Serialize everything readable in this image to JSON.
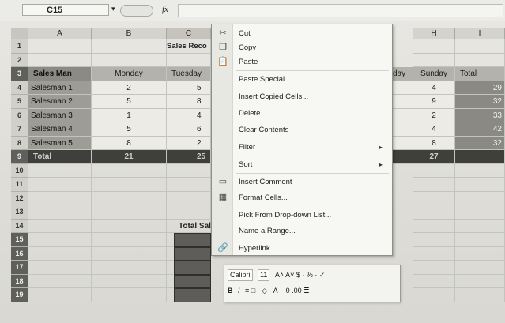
{
  "formula_bar": {
    "name_box": "C15",
    "fx": "fx"
  },
  "columns": [
    "A",
    "B",
    "C",
    "H",
    "I"
  ],
  "columns_partial": {
    "D_label": "day"
  },
  "rows": [
    "1",
    "2",
    "3",
    "4",
    "5",
    "6",
    "7",
    "8",
    "9",
    "10",
    "11",
    "12",
    "13",
    "14",
    "15",
    "16",
    "17",
    "18",
    "19"
  ],
  "sheet": {
    "title": "Sales Reco",
    "headers": {
      "a": "Sales Man",
      "b": "Monday",
      "c": "Tuesday",
      "d": "day",
      "h": "Sunday",
      "i": "Total"
    },
    "people": [
      {
        "name": "Salesman 1",
        "monday": "2",
        "tuesday": "5",
        "sunday": "4",
        "total": "29"
      },
      {
        "name": "Salesman 2",
        "monday": "5",
        "tuesday": "8",
        "sunday": "9",
        "total": "32"
      },
      {
        "name": "Salesman 3",
        "monday": "1",
        "tuesday": "4",
        "sunday": "2",
        "total": "33"
      },
      {
        "name": "Salesman 4",
        "monday": "5",
        "tuesday": "6",
        "sunday": "4",
        "total": "42"
      },
      {
        "name": "Salesman 5",
        "monday": "8",
        "tuesday": "2",
        "sunday": "8",
        "total": "32"
      }
    ],
    "total_row": {
      "label": "Total",
      "monday": "21",
      "tuesday": "25",
      "sunday": "27"
    },
    "total_sales_label": "Total Sal"
  },
  "context_menu": {
    "items": [
      {
        "label": "Cut",
        "icon": "scissors-icon",
        "glyph": "✂"
      },
      {
        "label": "Copy",
        "icon": "copy-icon",
        "glyph": "❐"
      },
      {
        "label": "Paste",
        "icon": "paste-icon",
        "glyph": "📋"
      },
      {
        "label": "Paste Special...",
        "icon": "",
        "glyph": ""
      },
      {
        "label": "Insert Copied Cells...",
        "icon": "",
        "glyph": ""
      },
      {
        "label": "Delete...",
        "icon": "",
        "glyph": ""
      },
      {
        "label": "Clear Contents",
        "icon": "",
        "glyph": ""
      },
      {
        "label": "Filter",
        "icon": "",
        "glyph": "",
        "submenu": true
      },
      {
        "label": "Sort",
        "icon": "",
        "glyph": "",
        "submenu": true
      },
      {
        "label": "Insert Comment",
        "icon": "comment-icon",
        "glyph": "▭"
      },
      {
        "label": "Format Cells...",
        "icon": "format-cells-icon",
        "glyph": "▦"
      },
      {
        "label": "Pick From Drop-down List...",
        "icon": "",
        "glyph": ""
      },
      {
        "label": "Name a Range...",
        "icon": "",
        "glyph": ""
      },
      {
        "label": "Hyperlink...",
        "icon": "hyperlink-icon",
        "glyph": "🔗"
      }
    ],
    "submenu_arrow": "▸"
  },
  "mini_toolbar": {
    "font": "Calibri",
    "size": "11",
    "row1_rest": "A˄ A˅  $ · % · ✓",
    "row2": {
      "bold": "B",
      "italic": "I",
      "rest": "≡ □ · ◇ · A · .0 .00 ≣"
    }
  },
  "colors": {
    "header_dark": "#7f7f7a",
    "total_row": "#3f3f3c",
    "menu_bg": "#f7f7f4"
  }
}
